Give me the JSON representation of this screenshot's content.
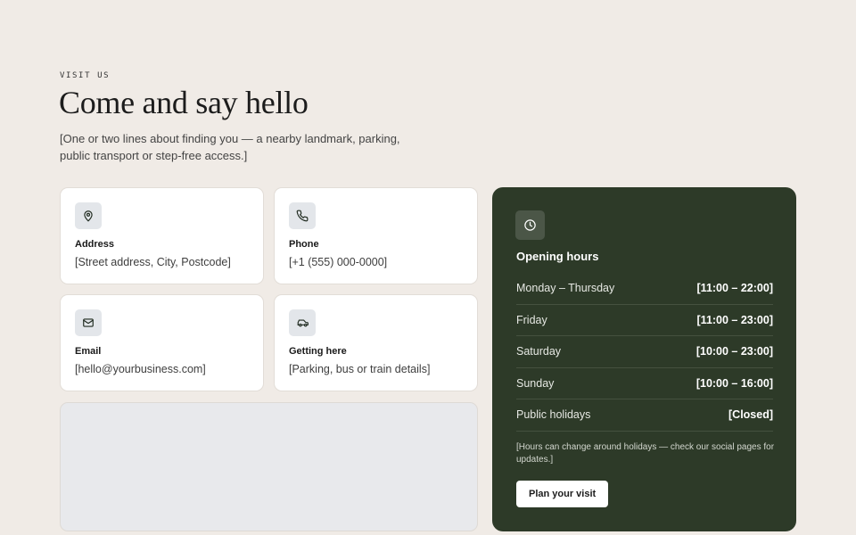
{
  "section": {
    "eyebrow": "VISIT US",
    "title": "Come and say hello",
    "intro": "[One or two lines about finding you — a nearby landmark, parking, public transport or step-free access.]"
  },
  "cards": {
    "address": {
      "title": "Address",
      "value": "[Street address, City, Postcode]",
      "icon": "map-pin-icon"
    },
    "phone": {
      "title": "Phone",
      "value": "[+1 (555) 000-0000]",
      "icon": "phone-icon"
    },
    "email": {
      "title": "Email",
      "value": "[hello@yourbusiness.com]",
      "icon": "mail-icon"
    },
    "directions": {
      "title": "Getting here",
      "value": "[Parking, bus or train details]",
      "icon": "car-icon"
    }
  },
  "hours": {
    "icon": "clock-icon",
    "title": "Opening hours",
    "rows": [
      {
        "day": "Monday – Thursday",
        "time": "[11:00 – 22:00]"
      },
      {
        "day": "Friday",
        "time": "[11:00 – 23:00]"
      },
      {
        "day": "Saturday",
        "time": "[10:00 – 23:00]"
      },
      {
        "day": "Sunday",
        "time": "[10:00 – 16:00]"
      },
      {
        "day": "Public holidays",
        "time": "[Closed]"
      }
    ],
    "note": "[Hours can change around holidays — check our social pages for updates.]",
    "cta_label": "Plan your visit"
  },
  "colors": {
    "background": "#f0ebe6",
    "hours_panel": "#2d3a28",
    "card": "#ffffff",
    "icon_tile": "#e3e6ea",
    "map_placeholder": "#e8e9ec"
  }
}
